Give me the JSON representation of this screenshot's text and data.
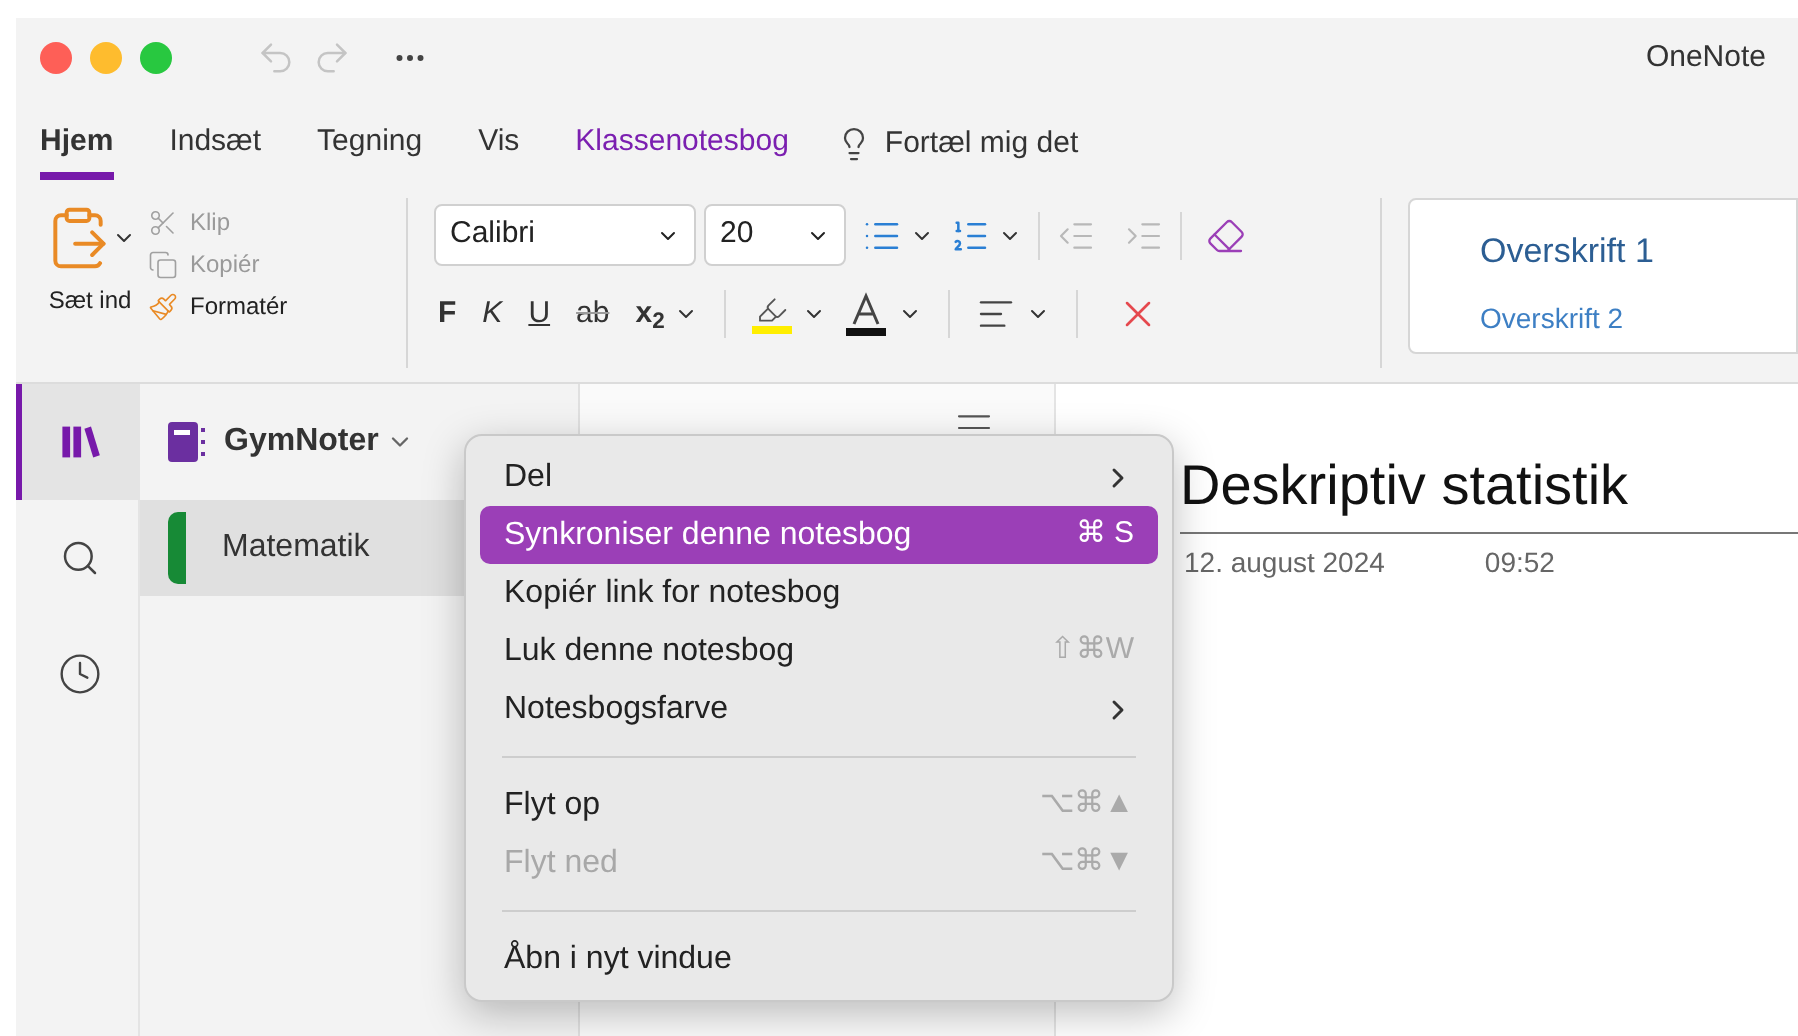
{
  "window": {
    "title": "OneNote"
  },
  "tabs": [
    {
      "label": "Hjem",
      "selected": true,
      "kind": "tab"
    },
    {
      "label": "Indsæt",
      "selected": false,
      "kind": "tab"
    },
    {
      "label": "Tegning",
      "selected": false,
      "kind": "tab"
    },
    {
      "label": "Vis",
      "selected": false,
      "kind": "tab"
    },
    {
      "label": "Klassenotesbog",
      "selected": false,
      "kind": "class"
    },
    {
      "label": "Fortæl mig det",
      "selected": false,
      "kind": "search"
    }
  ],
  "ribbon": {
    "paste": {
      "label": "Sæt ind"
    },
    "clipboard": [
      {
        "label": "Klip",
        "kind": "cut",
        "disabled": true
      },
      {
        "label": "Kopiér",
        "kind": "copy",
        "disabled": true
      },
      {
        "label": "Formatér",
        "kind": "format",
        "disabled": false
      }
    ],
    "font": "Calibri",
    "size": "20",
    "format": [
      {
        "label": "F",
        "kind": "bold"
      },
      {
        "label": "K",
        "kind": "italic"
      },
      {
        "label": "U",
        "kind": "underline"
      },
      {
        "label": "ab",
        "kind": "strike"
      },
      {
        "label": "x$_{2}$",
        "kind": "subscript"
      }
    ],
    "styles": [
      "Overskrift 1",
      "Overskrift 2"
    ]
  },
  "rail": [
    {
      "kind": "notebooks",
      "selected": true
    },
    {
      "kind": "search",
      "selected": false
    },
    {
      "kind": "recent",
      "selected": false
    }
  ],
  "notebook": {
    "name": "GymNoter",
    "sections": [
      {
        "name": "Matematik",
        "color": "#178a36",
        "selected": true
      }
    ]
  },
  "menu": [
    {
      "kind": "item",
      "label": "Del",
      "submenu": true,
      "selected": false,
      "disabled": false
    },
    {
      "kind": "item",
      "label": "Synkroniser denne notesbog",
      "shortcut": "⌘ S",
      "selected": true,
      "disabled": false
    },
    {
      "kind": "item",
      "label": "Kopiér link for notesbog",
      "selected": false,
      "disabled": false
    },
    {
      "kind": "item",
      "label": "Luk denne notesbog",
      "shortcut": "⇧⌘W",
      "selected": false,
      "disabled": false
    },
    {
      "kind": "item",
      "label": "Notesbogsfarve",
      "submenu": true,
      "selected": false,
      "disabled": false
    },
    {
      "kind": "separator"
    },
    {
      "kind": "item",
      "label": "Flyt op",
      "shortcut": "⌥⌘▲",
      "selected": false,
      "disabled": false
    },
    {
      "kind": "item",
      "label": "Flyt ned",
      "shortcut": "⌥⌘▼",
      "selected": false,
      "disabled": true
    },
    {
      "kind": "separator"
    },
    {
      "kind": "item",
      "label": "Åbn i nyt vindue",
      "selected": false,
      "disabled": false
    }
  ],
  "page": {
    "title": "Deskriptiv statistik",
    "date": "12. august 2024",
    "time": "09:52"
  }
}
